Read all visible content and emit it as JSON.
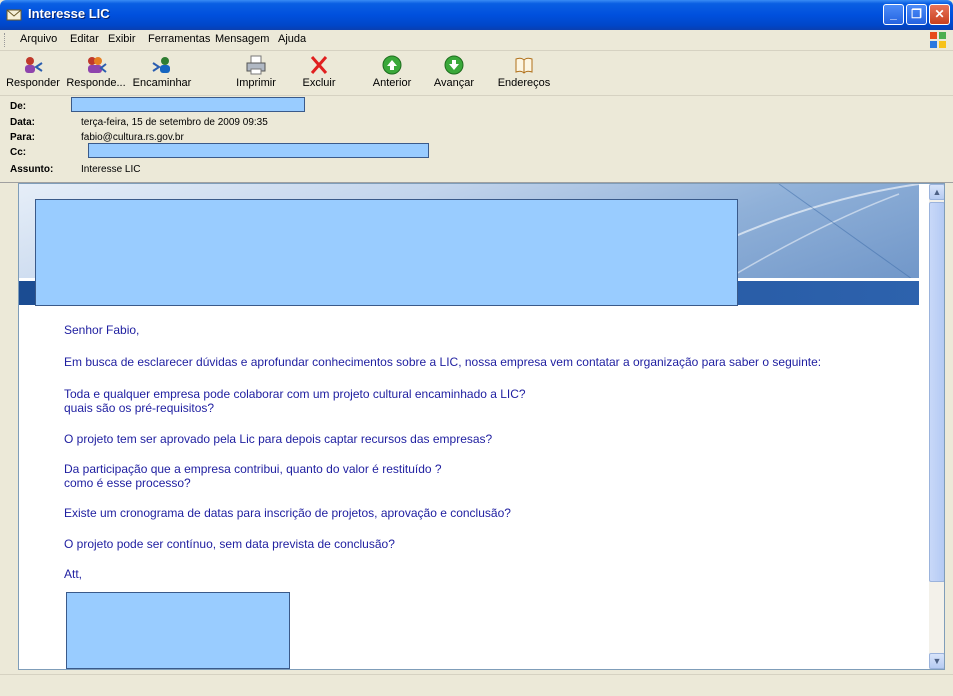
{
  "window": {
    "title": "Interesse LIC"
  },
  "menu": [
    "Arquivo",
    "Editar",
    "Exibir",
    "Ferramentas",
    "Mensagem",
    "Ajuda"
  ],
  "toolbar": {
    "reply": "Responder",
    "reply_all": "Responde...",
    "forward": "Encaminhar",
    "print": "Imprimir",
    "delete": "Excluir",
    "previous": "Anterior",
    "next": "Avançar",
    "addresses": "Endereços"
  },
  "headers": {
    "from_label": "De:",
    "date_label": "Data:",
    "date_value": "terça-feira, 15 de setembro de 2009 09:35",
    "to_label": "Para:",
    "to_value": "fabio@cultura.rs.gov.br",
    "cc_label": "Cc:",
    "subject_label": "Assunto:",
    "subject_value": "Interesse LIC"
  },
  "body": {
    "greeting": "Senhor Fabio,",
    "p1": "Em busca de esclarecer dúvidas e aprofundar conhecimentos sobre a LIC, nossa empresa vem contatar a organização para saber o seguinte:",
    "q1a": "Toda e qualquer empresa pode colaborar com um projeto cultural encaminhado a LIC?",
    "q1b": "quais são os pré-requisitos?",
    "q2": "O projeto tem ser aprovado pela Lic para depois captar recursos das empresas?",
    "q3a": "Da participação que a empresa contribui, quanto do valor é restituído ?",
    "q3b": "como é esse processo?",
    "q4": "Existe um cronograma de datas para inscrição de projetos, aprovação e conclusão?",
    "q5": "O projeto pode ser contínuo, sem data prevista de conclusão?",
    "signoff": "Att,"
  },
  "colors": {
    "title_bar": "#0050dd",
    "body_text": "#1e1ea0",
    "redaction": "#99ccff"
  }
}
